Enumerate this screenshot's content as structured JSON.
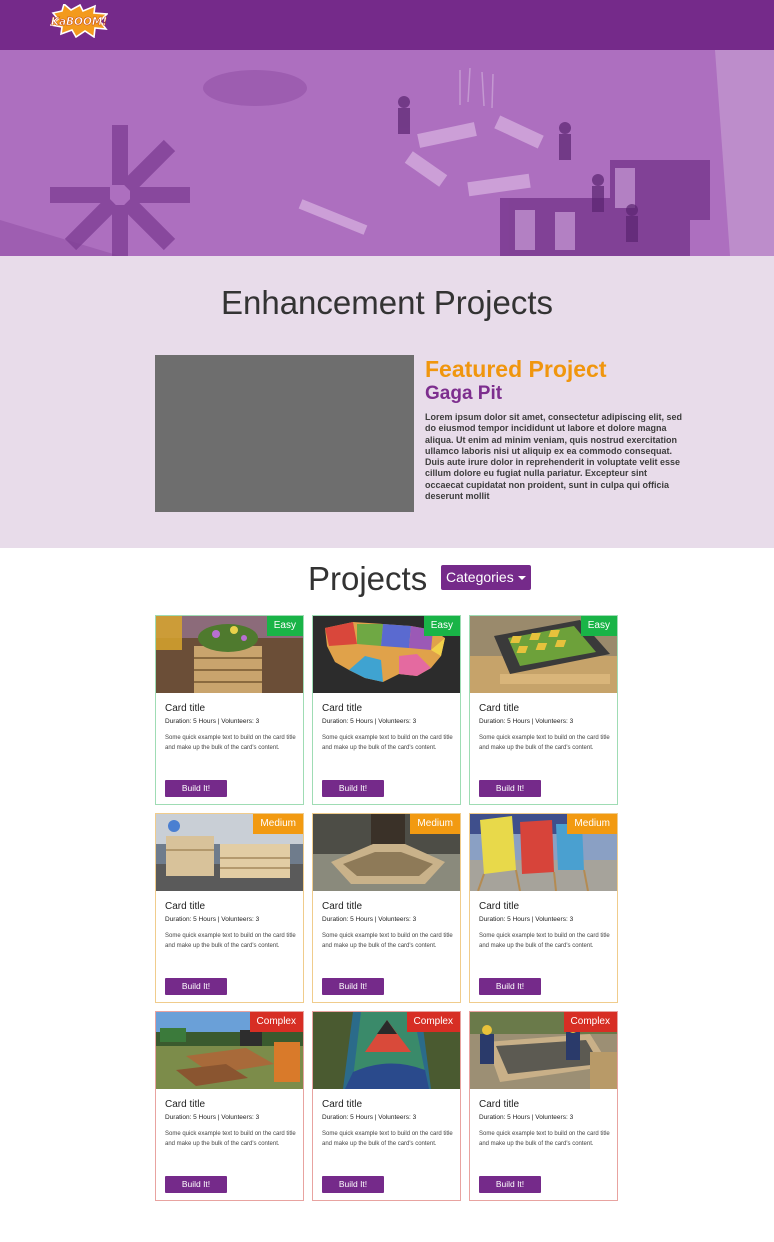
{
  "brand": {
    "logo_text": "KaBOOM!"
  },
  "colors": {
    "primary": "#752a8a",
    "featured_heading": "#f0960e",
    "easy": "#19b447",
    "medium": "#f29a11",
    "complex": "#d72e24"
  },
  "enhancement": {
    "title": "Enhancement Projects",
    "featured_heading": "Featured Project",
    "featured_name": "Gaga Pit",
    "featured_text": "Lorem ipsum dolor sit amet, consectetur adipiscing elit, sed do eiusmod tempor incididunt ut labore et dolore magna aliqua. Ut enim ad minim veniam, quis nostrud exercitation ullamco laboris nisi ut aliquip ex ea commodo consequat. Duis aute irure dolor in reprehenderit in voluptate velit esse cillum dolore eu fugiat nulla pariatur. Excepteur sint occaecat cupidatat non proident, sunt in culpa qui officia deserunt mollit"
  },
  "projects": {
    "title": "Projects",
    "categories_label": "Categories",
    "cards": [
      {
        "badge": "Easy",
        "title": "Card title",
        "meta": "Duration: 5 Hours | Volunteers: 3",
        "text": "Some quick example text to build on the card title and make up the bulk of the card's content.",
        "button": "Build It!"
      },
      {
        "badge": "Easy",
        "title": "Card title",
        "meta": "Duration: 5 Hours | Volunteers: 3",
        "text": "Some quick example text to build on the card title and make up the bulk of the card's content.",
        "button": "Build It!"
      },
      {
        "badge": "Easy",
        "title": "Card title",
        "meta": "Duration: 5 Hours | Volunteers: 3",
        "text": "Some quick example text to build on the card title and make up the bulk of the card's content.",
        "button": "Build It!"
      },
      {
        "badge": "Medium",
        "title": "Card title",
        "meta": "Duration: 5 Hours | Volunteers: 3",
        "text": "Some quick example text to build on the card title and make up the bulk of the card's content.",
        "button": "Build It!"
      },
      {
        "badge": "Medium",
        "title": "Card title",
        "meta": "Duration: 5 Hours | Volunteers: 3",
        "text": "Some quick example text to build on the card title and make up the bulk of the card's content.",
        "button": "Build It!"
      },
      {
        "badge": "Medium",
        "title": "Card title",
        "meta": "Duration: 5 Hours | Volunteers: 3",
        "text": "Some quick example text to build on the card title and make up the bulk of the card's content.",
        "button": "Build It!"
      },
      {
        "badge": "Complex",
        "title": "Card title",
        "meta": "Duration: 5 Hours | Volunteers: 3",
        "text": "Some quick example text to build on the card title and make up the bulk of the card's content.",
        "button": "Build It!"
      },
      {
        "badge": "Complex",
        "title": "Card title",
        "meta": "Duration: 5 Hours | Volunteers: 3",
        "text": "Some quick example text to build on the card title and make up the bulk of the card's content.",
        "button": "Build It!"
      },
      {
        "badge": "Complex",
        "title": "Card title",
        "meta": "Duration: 5 Hours | Volunteers: 3",
        "text": "Some quick example text to build on the card title and make up the bulk of the card's content.",
        "button": "Build It!"
      }
    ]
  }
}
